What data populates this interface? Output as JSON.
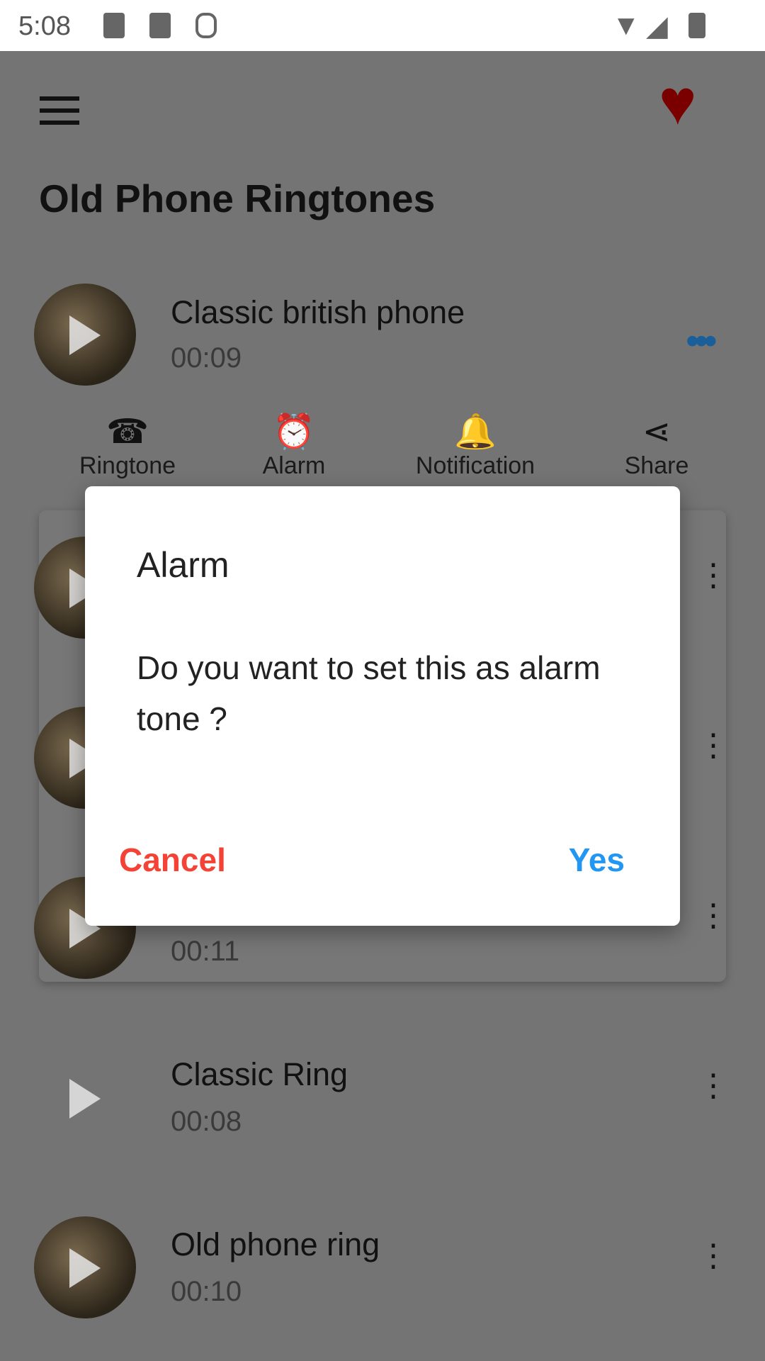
{
  "status_bar": {
    "time": "5:08"
  },
  "header": {
    "title": "Old Phone Ringtones"
  },
  "expanded_item": {
    "title": "Classic british phone",
    "duration": "00:09",
    "actions": [
      {
        "label": "Ringtone",
        "icon": "ringtone-phone-icon"
      },
      {
        "label": "Alarm",
        "icon": "alarm-clock-icon"
      },
      {
        "label": "Notification",
        "icon": "notification-bell-icon"
      },
      {
        "label": "Share",
        "icon": "share-icon"
      }
    ]
  },
  "items": [
    {
      "title": "",
      "duration": ""
    },
    {
      "title": "",
      "duration": ""
    },
    {
      "title": "",
      "duration": "00:11"
    },
    {
      "title": "Classic Ring",
      "duration": "00:08"
    },
    {
      "title": "Old phone ring",
      "duration": "00:10"
    }
  ],
  "dialog": {
    "title": "Alarm",
    "message": "Do you want to set this as alarm tone ?",
    "cancel": "Cancel",
    "confirm": "Yes"
  },
  "colors": {
    "cancel": "#f44336",
    "confirm": "#2196f3",
    "heart": "#7a0000",
    "more_active": "#1a5e9a"
  }
}
